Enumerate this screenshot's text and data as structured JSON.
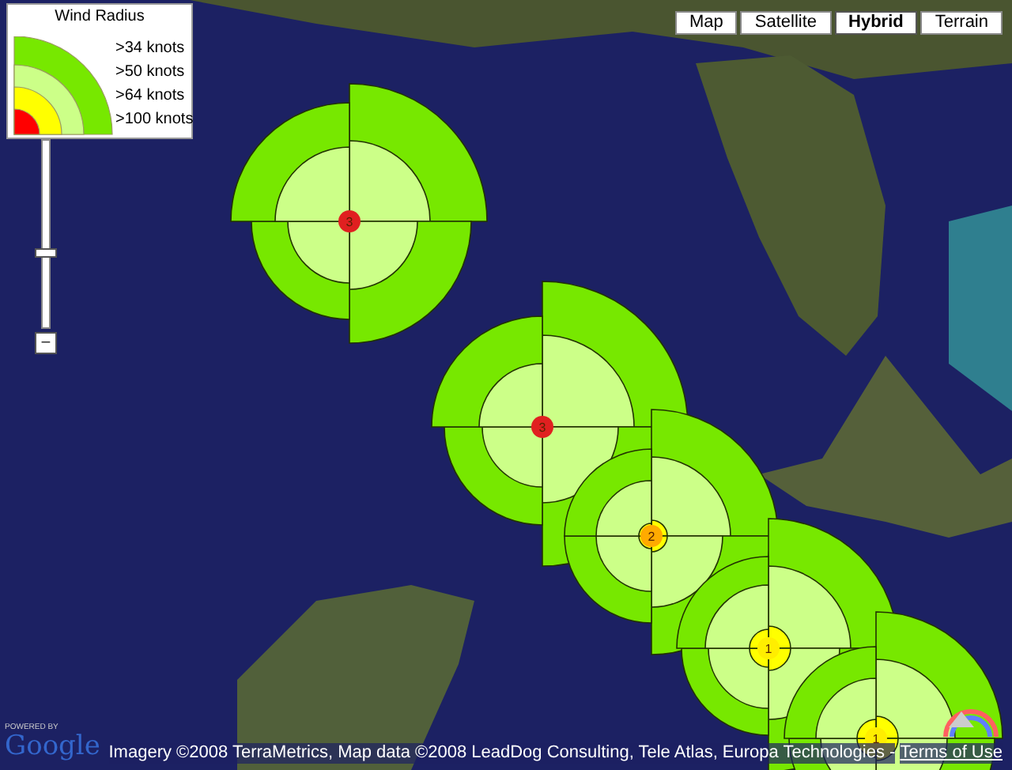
{
  "legend": {
    "title": "Wind Radius",
    "items": [
      {
        "label": ">34 knots",
        "color": "#77e800"
      },
      {
        "label": ">50 knots",
        "color": "#ccff88"
      },
      {
        "label": ">64 knots",
        "color": "#ffff00"
      },
      {
        "label": ">100 knots",
        "color": "#ff0000"
      }
    ]
  },
  "zoom": {
    "level": 0.38,
    "minus": "−"
  },
  "map_types": [
    {
      "label": "Map",
      "selected": false
    },
    {
      "label": "Satellite",
      "selected": false
    },
    {
      "label": "Hybrid",
      "selected": true
    },
    {
      "label": "Terrain",
      "selected": false
    }
  ],
  "storms": [
    {
      "category": "3",
      "color": "#e02020"
    },
    {
      "category": "3",
      "color": "#e02020"
    },
    {
      "category": "2",
      "color": "#ffaa00"
    },
    {
      "category": "1",
      "color": "#ffee00"
    },
    {
      "category": "1",
      "color": "#ffee00"
    }
  ],
  "logo": {
    "caption": "POWERED BY",
    "name": "Google"
  },
  "attribution": {
    "text": "Imagery ©2008 TerraMetrics, Map data ©2008 LeadDog Consulting, Tele Atlas, Europa Technologies -",
    "link": "Terms of Use"
  }
}
